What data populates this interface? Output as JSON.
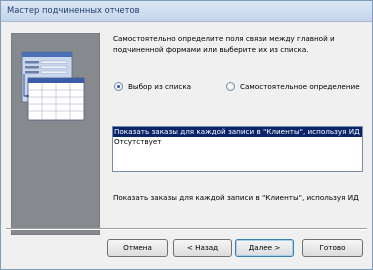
{
  "window": {
    "title": "Мастер подчиненных отчетов"
  },
  "description_lines": [
    "Самостоятельно определите поля связи между главной и",
    "подчиненной формами или выберите их из списка."
  ],
  "radios": [
    {
      "label": "Выбор из списка",
      "selected": true
    },
    {
      "label": "Самостоятельное определение",
      "selected": false
    }
  ],
  "list_items": [
    {
      "text": "Показать заказы для каждой записи в \"Клиенты\", используя ИД",
      "selected": true
    },
    {
      "text": "Отсутствует",
      "selected": false
    }
  ],
  "summary_text": "Показать заказы для каждой записи в \"Клиенты\", используя ИД",
  "buttons": {
    "cancel": "Отмена",
    "back": "< Назад",
    "next": "Далее >",
    "finish": "Готово"
  },
  "colors": {
    "selection": "#0a246a",
    "illustration_bg": "#868a8f"
  }
}
